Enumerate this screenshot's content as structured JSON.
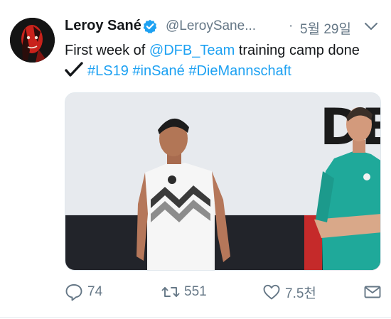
{
  "tweet": {
    "display_name": "Leroy Sané",
    "handle": "@LeroySane...",
    "separator": "·",
    "date": "5월 29일",
    "text_before": "First week of ",
    "mention": "@DFB_Team",
    "text_after": " training camp done",
    "hashtags": "#LS19 #inSané #DieMannschaft",
    "photo_text": "DE",
    "actions": {
      "replies": "74",
      "retweets": "551",
      "likes": "7.5천"
    }
  },
  "icons": {
    "verified": "verified-badge-icon",
    "chevron": "chevron-down-icon",
    "check": "check-mark-icon",
    "reply": "reply-icon",
    "retweet": "retweet-icon",
    "like": "heart-icon",
    "share": "share-icon"
  },
  "colors": {
    "link": "#1da1f2",
    "muted": "#657786",
    "text": "#14171a"
  }
}
